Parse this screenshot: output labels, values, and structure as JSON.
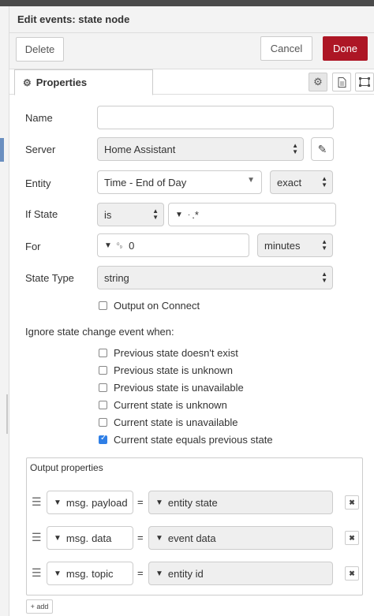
{
  "header": {
    "title": "Edit events: state node"
  },
  "toolbar": {
    "delete_label": "Delete",
    "cancel_label": "Cancel",
    "done_label": "Done"
  },
  "tabs": {
    "properties_label": "Properties"
  },
  "icons": {
    "properties_tab": "gear-icon",
    "settings": "gear-icon",
    "description": "document-icon",
    "appearance": "frame-icon",
    "edit_server": "pencil-icon",
    "drag_handle": "drag-handle-icon",
    "remove": "close-icon"
  },
  "colors": {
    "done_button": "#ad1625",
    "checkbox_checked": "#2f7fe6"
  },
  "form": {
    "name": {
      "label": "Name",
      "value": ""
    },
    "server": {
      "label": "Server",
      "value": "Home Assistant"
    },
    "entity": {
      "label": "Entity",
      "value": "Time - End of Day",
      "match": "exact"
    },
    "if_state": {
      "label": "If State",
      "operator": "is",
      "value": ".*"
    },
    "for": {
      "label": "For",
      "value": "0",
      "unit": "minutes"
    },
    "state_type": {
      "label": "State Type",
      "value": "string"
    },
    "output_on_connect": {
      "label": "Output on Connect",
      "checked": false
    }
  },
  "ignore": {
    "heading": "Ignore state change event when:",
    "options": [
      {
        "label": "Previous state doesn't exist",
        "checked": false
      },
      {
        "label": "Previous state is unknown",
        "checked": false
      },
      {
        "label": "Previous state is unavailable",
        "checked": false
      },
      {
        "label": "Current state is unknown",
        "checked": false
      },
      {
        "label": "Current state is unavailable",
        "checked": false
      },
      {
        "label": "Current state equals previous state",
        "checked": true
      }
    ]
  },
  "output": {
    "title": "Output properties",
    "rows": [
      {
        "prefix": "msg.",
        "property": "payload",
        "equals": "=",
        "value": "entity state"
      },
      {
        "prefix": "msg.",
        "property": "data",
        "equals": "=",
        "value": "event data"
      },
      {
        "prefix": "msg.",
        "property": "topic",
        "equals": "=",
        "value": "entity id"
      }
    ],
    "add_label": "+ add"
  }
}
